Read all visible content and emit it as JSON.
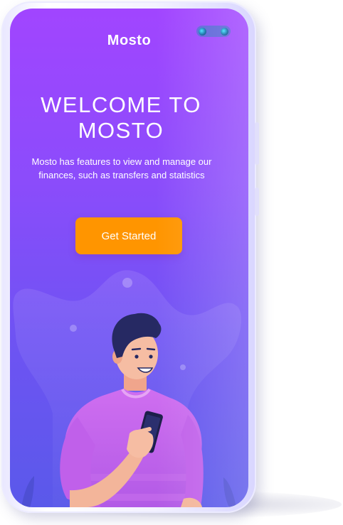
{
  "app": {
    "brand": "Mosto"
  },
  "welcome": {
    "headline_line1": "WELCOME TO",
    "headline_line2": "MOSTO",
    "subtitle": "Mosto has features to view and manage our finances, such as transfers and statistics",
    "cta_label": "Get Started"
  },
  "colors": {
    "gradient_top": "#a145ff",
    "gradient_bottom": "#5a59ea",
    "cta": "#ff9500",
    "text": "#ffffff"
  },
  "icons": {
    "camera": "camera-icon",
    "illustration": "person-with-phone-illustration"
  }
}
